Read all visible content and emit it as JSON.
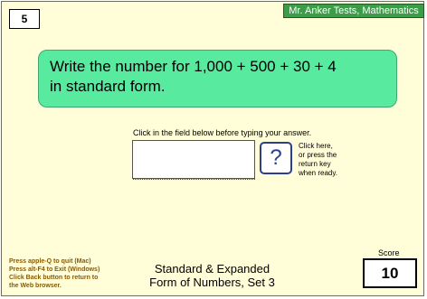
{
  "question": {
    "number": "5",
    "line1": "Write the number for 1,000 + 500 + 30 + 4",
    "line2": "in standard form."
  },
  "header": {
    "badge": "Mr. Anker Tests, Mathematics"
  },
  "answer": {
    "instruction": "Click in the field below before typing your answer.",
    "value": ""
  },
  "help": {
    "button_glyph": "?",
    "text1": "Click here,",
    "text2": "or press the",
    "text3": "return key",
    "text4": "when ready."
  },
  "notes": {
    "line1": "Press apple-Q to quit (Mac)",
    "line2": "Press alt-F4 to Exit (Windows)",
    "line3": "Click Back button to return to",
    "line4": "the Web browser."
  },
  "footer": {
    "title_line1": "Standard & Expanded",
    "title_line2": "Form of Numbers, Set 3"
  },
  "score": {
    "label": "Score",
    "value": "10"
  },
  "colors": {
    "background": "#fffed8",
    "prompt_box": "#58eba0",
    "header_badge": "#3c9c48",
    "help_button_border": "#2a3f8f",
    "notes_text": "#8a5a00"
  }
}
